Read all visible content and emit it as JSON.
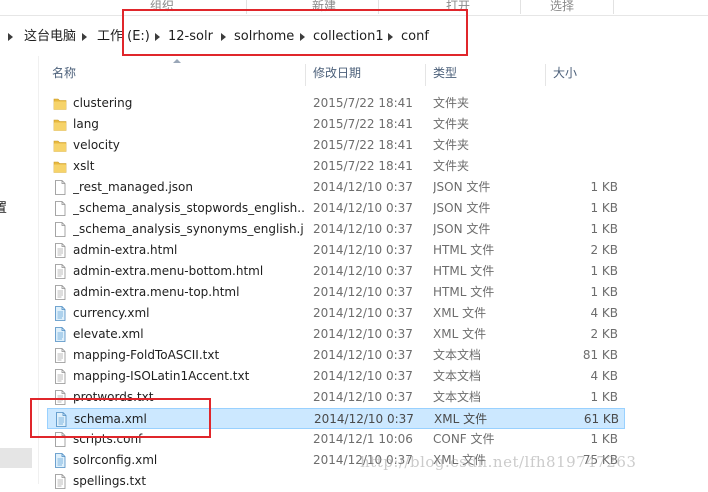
{
  "ribbon": {
    "groups": [
      "组织",
      "新建",
      "打开",
      "选择"
    ]
  },
  "address": {
    "crumbs": [
      "这台电脑",
      "工作 (E:)",
      "12-solr",
      "solrhome",
      "collection1",
      "conf"
    ]
  },
  "nav": {
    "cut_char": "置"
  },
  "columns": {
    "name": "名称",
    "date": "修改日期",
    "type": "类型",
    "size": "大小"
  },
  "files": [
    {
      "name": "clustering",
      "date": "2015/7/22 18:41",
      "type": "文件夹",
      "size": "",
      "icon": "folder"
    },
    {
      "name": "lang",
      "date": "2015/7/22 18:41",
      "type": "文件夹",
      "size": "",
      "icon": "folder"
    },
    {
      "name": "velocity",
      "date": "2015/7/22 18:41",
      "type": "文件夹",
      "size": "",
      "icon": "folder"
    },
    {
      "name": "xslt",
      "date": "2015/7/22 18:41",
      "type": "文件夹",
      "size": "",
      "icon": "folder"
    },
    {
      "name": "_rest_managed.json",
      "date": "2014/12/10 0:37",
      "type": "JSON 文件",
      "size": "1 KB",
      "icon": "file"
    },
    {
      "name": "_schema_analysis_stopwords_english....",
      "date": "2014/12/10 0:37",
      "type": "JSON 文件",
      "size": "1 KB",
      "icon": "file"
    },
    {
      "name": "_schema_analysis_synonyms_english.j...",
      "date": "2014/12/10 0:37",
      "type": "JSON 文件",
      "size": "1 KB",
      "icon": "file"
    },
    {
      "name": "admin-extra.html",
      "date": "2014/12/10 0:37",
      "type": "HTML 文件",
      "size": "2 KB",
      "icon": "text"
    },
    {
      "name": "admin-extra.menu-bottom.html",
      "date": "2014/12/10 0:37",
      "type": "HTML 文件",
      "size": "1 KB",
      "icon": "text"
    },
    {
      "name": "admin-extra.menu-top.html",
      "date": "2014/12/10 0:37",
      "type": "HTML 文件",
      "size": "1 KB",
      "icon": "text"
    },
    {
      "name": "currency.xml",
      "date": "2014/12/10 0:37",
      "type": "XML 文件",
      "size": "4 KB",
      "icon": "xml"
    },
    {
      "name": "elevate.xml",
      "date": "2014/12/10 0:37",
      "type": "XML 文件",
      "size": "2 KB",
      "icon": "xml"
    },
    {
      "name": "mapping-FoldToASCII.txt",
      "date": "2014/12/10 0:37",
      "type": "文本文档",
      "size": "81 KB",
      "icon": "text"
    },
    {
      "name": "mapping-ISOLatin1Accent.txt",
      "date": "2014/12/10 0:37",
      "type": "文本文档",
      "size": "4 KB",
      "icon": "text"
    },
    {
      "name": "protwords.txt",
      "date": "2014/12/10 0:37",
      "type": "文本文档",
      "size": "1 KB",
      "icon": "text"
    },
    {
      "name": "schema.xml",
      "date": "2014/12/10 0:37",
      "type": "XML 文件",
      "size": "61 KB",
      "icon": "xml",
      "selected": true
    },
    {
      "name": "scripts.conf",
      "date": "2014/12/1 10:06",
      "type": "CONF 文件",
      "size": "1 KB",
      "icon": "file"
    },
    {
      "name": "solrconfig.xml",
      "date": "2014/12/10 0:37",
      "type": "XML 文件",
      "size": "75 KB",
      "icon": "xml"
    },
    {
      "name": "spellings.txt",
      "date": "",
      "type": "",
      "size": "",
      "icon": "text"
    }
  ],
  "watermark": "http://blog.csdn.net/lfh819747263",
  "colors": {
    "highlight_box": "#e0262b",
    "selection_bg": "#cce8ff",
    "selection_border": "#99d1ff",
    "folder": "#e8b93f",
    "header_text": "#4c607a"
  }
}
